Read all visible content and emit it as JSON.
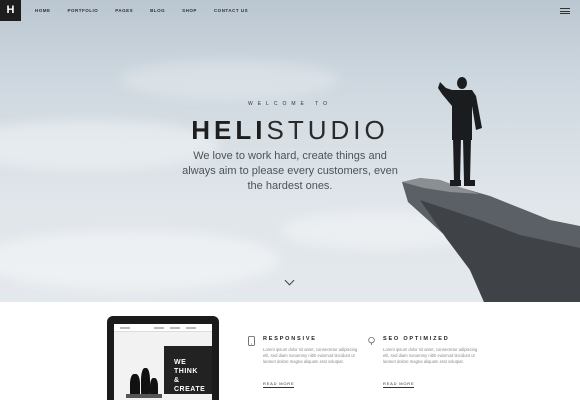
{
  "logo": "H",
  "nav": {
    "items": [
      "HOME",
      "PORTFOLIO",
      "PAGES",
      "BLOG",
      "SHOP",
      "CONTACT US"
    ]
  },
  "hero": {
    "welcome": "WELCOME TO",
    "title_bold": "HELI",
    "title_light": "STUDIO",
    "tagline": "We love to work hard, create things and always aim to please every customers, even the hardest ones."
  },
  "tablet": {
    "headline_line1": "WE THINK",
    "headline_line2": "& CREATE"
  },
  "features": [
    {
      "icon": "phone-icon",
      "title": "RESPONSIVE",
      "text": "Lorem ipsum dolor sit amet, consectetur adipiscing elit, sed diam nonummy nibh euismod tincidunt ut laoreet dolore magna aliquam erat volutpat.",
      "link": "READ MORE"
    },
    {
      "icon": "seo-icon",
      "title": "SEO OPTIMIZED",
      "text": "Lorem ipsum dolor sit amet, consectetur adipiscing elit, sed diam nonummy nibh euismod tincidunt ut laoreet dolore magna aliquam erat volutpat.",
      "link": "READ MORE"
    }
  ],
  "colors": {
    "dark": "#1d1d1d",
    "rock": "#5a5e63"
  }
}
